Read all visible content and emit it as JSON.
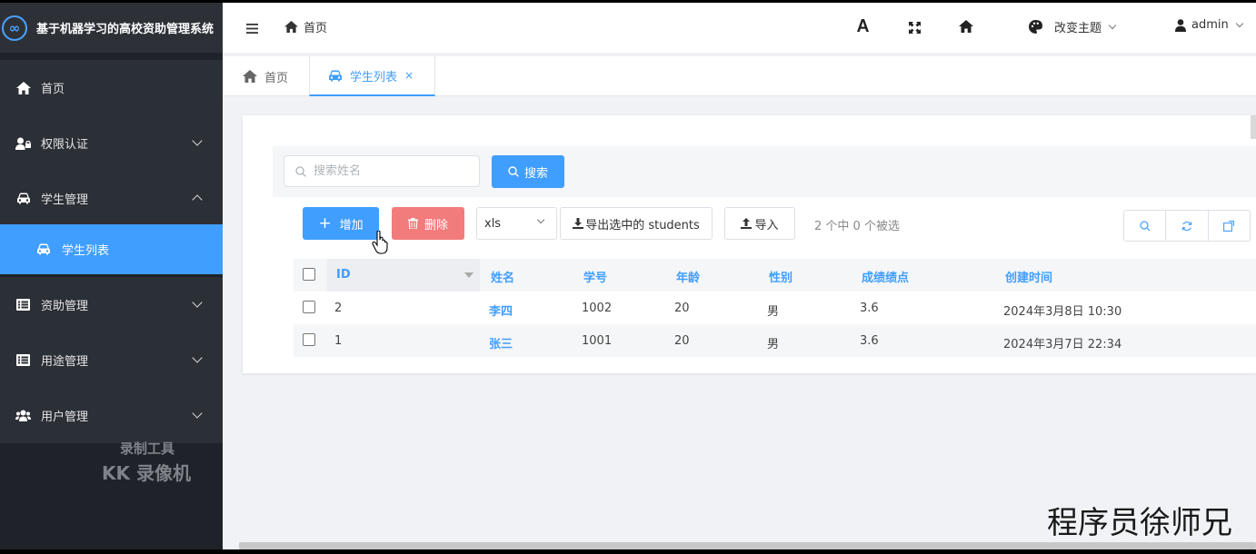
{
  "app": {
    "title": "基于机器学习的高校资助管理系统",
    "logo_glyph": "∞"
  },
  "sidebar": {
    "items": [
      {
        "label": "首页",
        "icon": "home-icon"
      },
      {
        "label": "权限认证",
        "icon": "user-lock-icon"
      },
      {
        "label": "学生管理",
        "icon": "car-icon",
        "expanded": true
      },
      {
        "label": "学生列表",
        "icon": "car-icon",
        "active": true
      },
      {
        "label": "资助管理",
        "icon": "list-icon"
      },
      {
        "label": "用途管理",
        "icon": "list-icon"
      },
      {
        "label": "用户管理",
        "icon": "users-icon"
      }
    ]
  },
  "header": {
    "breadcrumb": "首页",
    "theme_label": "改变主题",
    "user": "admin"
  },
  "tabs": [
    {
      "label": "首页"
    },
    {
      "label": "学生列表",
      "active": true,
      "close": "×"
    }
  ],
  "search": {
    "placeholder": "搜索姓名",
    "button": "搜索"
  },
  "toolbar": {
    "add": "增加",
    "delete": "删除",
    "format": "xls",
    "export": "导出选中的 students",
    "import": "导入",
    "selection_status": "2 个中 0 个被选"
  },
  "table": {
    "columns": [
      "ID",
      "姓名",
      "学号",
      "年龄",
      "性别",
      "成绩绩点",
      "创建时间"
    ],
    "rows": [
      {
        "id": "2",
        "name": "李四",
        "student_no": "1002",
        "age": "20",
        "gender": "男",
        "gpa": "3.6",
        "created": "2024年3月8日 10:30"
      },
      {
        "id": "1",
        "name": "张三",
        "student_no": "1001",
        "age": "20",
        "gender": "男",
        "gpa": "3.6",
        "created": "2024年3月7日 22:34"
      }
    ]
  },
  "overlay": {
    "watermark_line1": "录制工具",
    "watermark_line2": "KK 录像机",
    "signature": "程序员徐师兄"
  },
  "colors": {
    "accent": "#409eff",
    "danger": "#f27c7c",
    "sidebar_bg": "#2b2f36"
  }
}
